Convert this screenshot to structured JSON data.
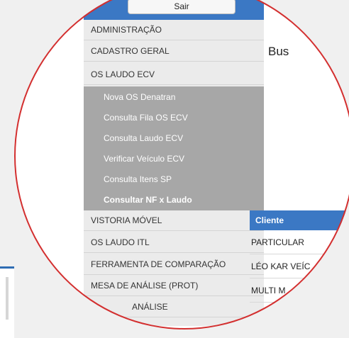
{
  "header": {
    "exit_label": "Sair"
  },
  "main": {
    "search_label": "Bus"
  },
  "sidebar": {
    "sections": [
      {
        "label": "ADMINISTRAÇÃO"
      },
      {
        "label": "CADASTRO GERAL"
      },
      {
        "label": "OS LAUDO ECV"
      },
      {
        "label": "VISTORIA MÓVEL"
      },
      {
        "label": "OS LAUDO ITL"
      },
      {
        "label": "FERRAMENTA DE COMPARAÇÃO"
      },
      {
        "label": "MESA DE ANÁLISE (PROT)"
      },
      {
        "label": "ANÁLISE"
      }
    ],
    "os_laudo_ecv_items": [
      {
        "label": "Nova OS Denatran"
      },
      {
        "label": "Consulta Fila OS ECV"
      },
      {
        "label": "Consulta Laudo ECV"
      },
      {
        "label": "Verificar Veículo ECV"
      },
      {
        "label": "Consulta Itens SP"
      },
      {
        "label": "Consultar NF x Laudo"
      }
    ]
  },
  "table": {
    "header": "Cliente",
    "rows": [
      "PARTICULAR",
      "LÉO KAR VEÍC",
      "MULTI M"
    ]
  },
  "colors": {
    "accent": "#3b78c4",
    "zoom_ring": "#d32f2f"
  }
}
